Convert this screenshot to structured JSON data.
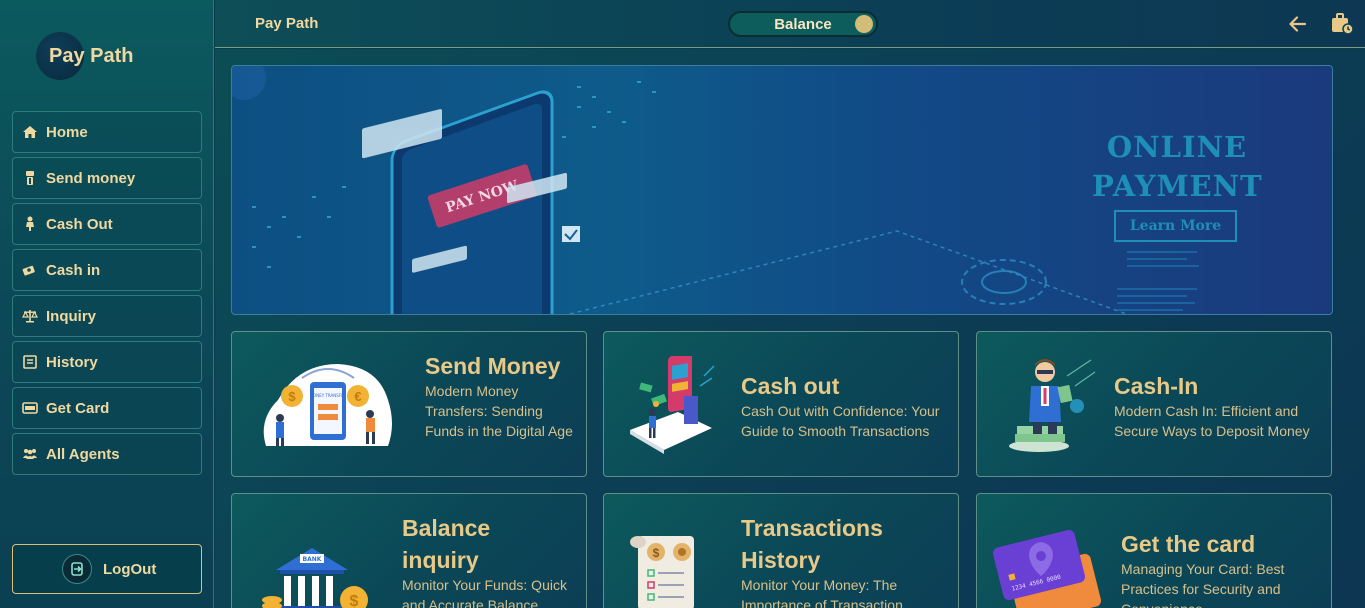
{
  "brand": {
    "name": "Pay Path"
  },
  "sidebar": {
    "items": [
      {
        "label": "Home",
        "icon": "home-icon"
      },
      {
        "label": "Send money",
        "icon": "money-icon"
      },
      {
        "label": "Cash Out",
        "icon": "cash-out-icon"
      },
      {
        "label": "Cash in",
        "icon": "cash-in-icon"
      },
      {
        "label": "Inquiry",
        "icon": "scale-icon"
      },
      {
        "label": "History",
        "icon": "history-icon"
      },
      {
        "label": "Get Card",
        "icon": "card-icon"
      },
      {
        "label": "All Agents",
        "icon": "agents-icon"
      }
    ],
    "logout_label": "LogOut"
  },
  "header": {
    "title": "Pay Path",
    "balance_label": "Balance"
  },
  "banner": {
    "title_line1": "ONLINE",
    "title_line2": "PAYMENT",
    "button_label": "Learn More",
    "graphic_text": "PAY NOW"
  },
  "cards": [
    {
      "title": "Send Money",
      "desc": "Modern Money Transfers: Sending Funds in the Digital Age",
      "graphic_text": "MONEY TRANSFER"
    },
    {
      "title": "Cash out",
      "desc": "Cash Out with Confidence: Your Guide to Smooth Transactions"
    },
    {
      "title": "Cash-In",
      "desc": "Modern Cash In: Efficient and Secure Ways to Deposit Money"
    },
    {
      "title": "Balance inquiry",
      "desc": "Monitor Your Funds: Quick and Accurate Balance",
      "graphic_text": "BANK"
    },
    {
      "title": "Transactions History",
      "desc": "Monitor Your Money: The Importance of Transaction"
    },
    {
      "title": "Get the card",
      "desc": "Managing Your Card: Best Practices for Security and Convenience"
    }
  ],
  "colors": {
    "accent": "#e9c987",
    "border": "#2d7b7b",
    "banner_text": "#1e8fb8"
  }
}
